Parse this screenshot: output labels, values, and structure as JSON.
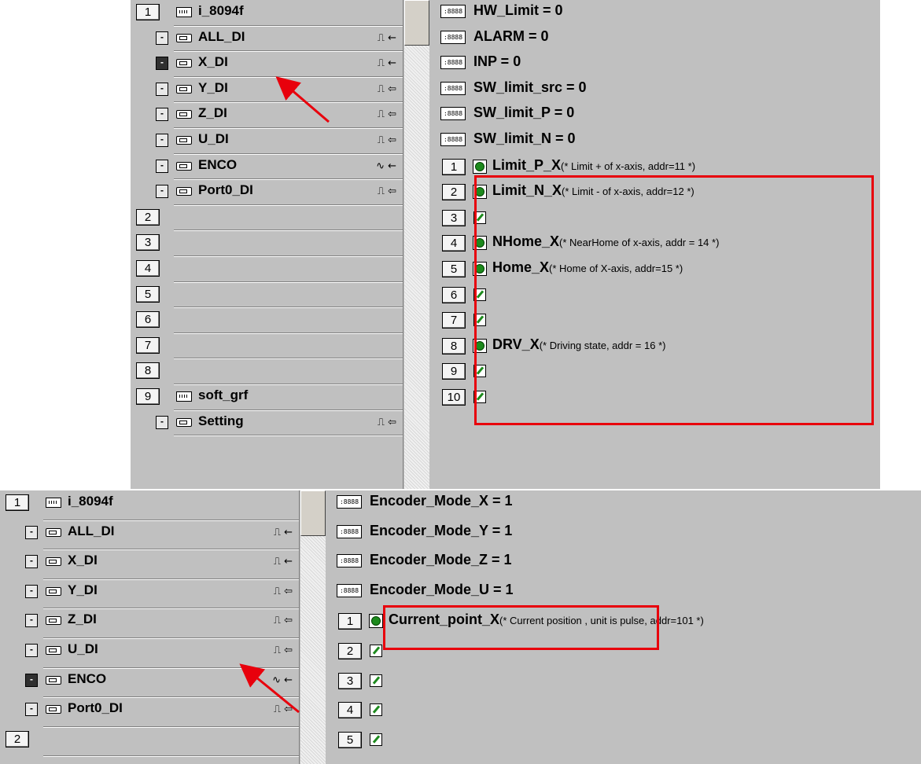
{
  "top": {
    "tree": [
      {
        "type": "group",
        "num": "1",
        "label": "i_8094f"
      },
      {
        "type": "dev",
        "label": "ALL_DI",
        "sig": "⎍ ←"
      },
      {
        "type": "dev",
        "label": "X_DI",
        "sig": "⎍ ←",
        "selected": true
      },
      {
        "type": "dev",
        "label": "Y_DI",
        "sig": "⎍ ⇦"
      },
      {
        "type": "dev",
        "label": "Z_DI",
        "sig": "⎍ ⇦"
      },
      {
        "type": "dev",
        "label": "U_DI",
        "sig": "⎍ ⇦"
      },
      {
        "type": "dev",
        "label": "ENCO",
        "sig": "∿ ←"
      },
      {
        "type": "dev",
        "label": "Port0_DI",
        "sig": "⎍ ⇦"
      },
      {
        "type": "slot",
        "num": "2"
      },
      {
        "type": "slot",
        "num": "3"
      },
      {
        "type": "slot",
        "num": "4"
      },
      {
        "type": "slot",
        "num": "5"
      },
      {
        "type": "slot",
        "num": "6"
      },
      {
        "type": "slot",
        "num": "7"
      },
      {
        "type": "slot",
        "num": "8"
      },
      {
        "type": "group",
        "num": "9",
        "label": "soft_grf"
      },
      {
        "type": "dev",
        "label": "Setting",
        "sig": "⎍ ⇦"
      }
    ],
    "vars": [
      {
        "type": "const",
        "label": "HW_Limit = 0"
      },
      {
        "type": "const",
        "label": "ALARM = 0"
      },
      {
        "type": "const",
        "label": "INP = 0"
      },
      {
        "type": "const",
        "label": "SW_limit_src = 0"
      },
      {
        "type": "const",
        "label": "SW_limit_P = 0"
      },
      {
        "type": "const",
        "label": "SW_limit_N = 0"
      },
      {
        "type": "bool",
        "num": "1",
        "label": "Limit_P_X",
        "comment": "(* Limit + of x-axis, addr=11 *)"
      },
      {
        "type": "bool",
        "num": "2",
        "label": "Limit_N_X",
        "comment": "(* Limit - of x-axis, addr=12 *)"
      },
      {
        "type": "empty",
        "num": "3"
      },
      {
        "type": "bool",
        "num": "4",
        "label": "NHome_X",
        "comment": "(* NearHome of x-axis, addr = 14 *)"
      },
      {
        "type": "bool",
        "num": "5",
        "label": "Home_X",
        "comment": "(* Home of X-axis, addr=15 *)"
      },
      {
        "type": "empty",
        "num": "6"
      },
      {
        "type": "empty",
        "num": "7"
      },
      {
        "type": "bool",
        "num": "8",
        "label": "DRV_X",
        "comment": "(* Driving state, addr = 16 *)"
      },
      {
        "type": "empty",
        "num": "9"
      },
      {
        "type": "empty",
        "num": "10"
      }
    ]
  },
  "bottom": {
    "tree": [
      {
        "type": "group",
        "num": "1",
        "label": "i_8094f"
      },
      {
        "type": "dev",
        "label": "ALL_DI",
        "sig": "⎍ ←"
      },
      {
        "type": "dev",
        "label": "X_DI",
        "sig": "⎍ ←"
      },
      {
        "type": "dev",
        "label": "Y_DI",
        "sig": "⎍ ⇦"
      },
      {
        "type": "dev",
        "label": "Z_DI",
        "sig": "⎍ ⇦"
      },
      {
        "type": "dev",
        "label": "U_DI",
        "sig": "⎍ ⇦"
      },
      {
        "type": "dev",
        "label": "ENCO",
        "sig": "∿ ←",
        "selected": true
      },
      {
        "type": "dev",
        "label": "Port0_DI",
        "sig": "⎍ ⇦"
      },
      {
        "type": "slot",
        "num": "2"
      }
    ],
    "vars": [
      {
        "type": "const",
        "label": "Encoder_Mode_X = 1"
      },
      {
        "type": "const",
        "label": "Encoder_Mode_Y = 1"
      },
      {
        "type": "const",
        "label": "Encoder_Mode_Z = 1"
      },
      {
        "type": "const",
        "label": "Encoder_Mode_U = 1"
      },
      {
        "type": "bool",
        "num": "1",
        "label": "Current_point_X",
        "comment": "(* Current position , unit is pulse, addr=101 *)"
      },
      {
        "type": "empty",
        "num": "2"
      },
      {
        "type": "empty",
        "num": "3"
      },
      {
        "type": "empty",
        "num": "4"
      },
      {
        "type": "empty",
        "num": "5"
      }
    ]
  },
  "icons": {
    "const_icon_text": ":8888",
    "minus": "-"
  },
  "colors": {
    "highlight": "#e8000c",
    "panel": "#c0c0c0",
    "bool_icon": "#1d8a1d"
  }
}
